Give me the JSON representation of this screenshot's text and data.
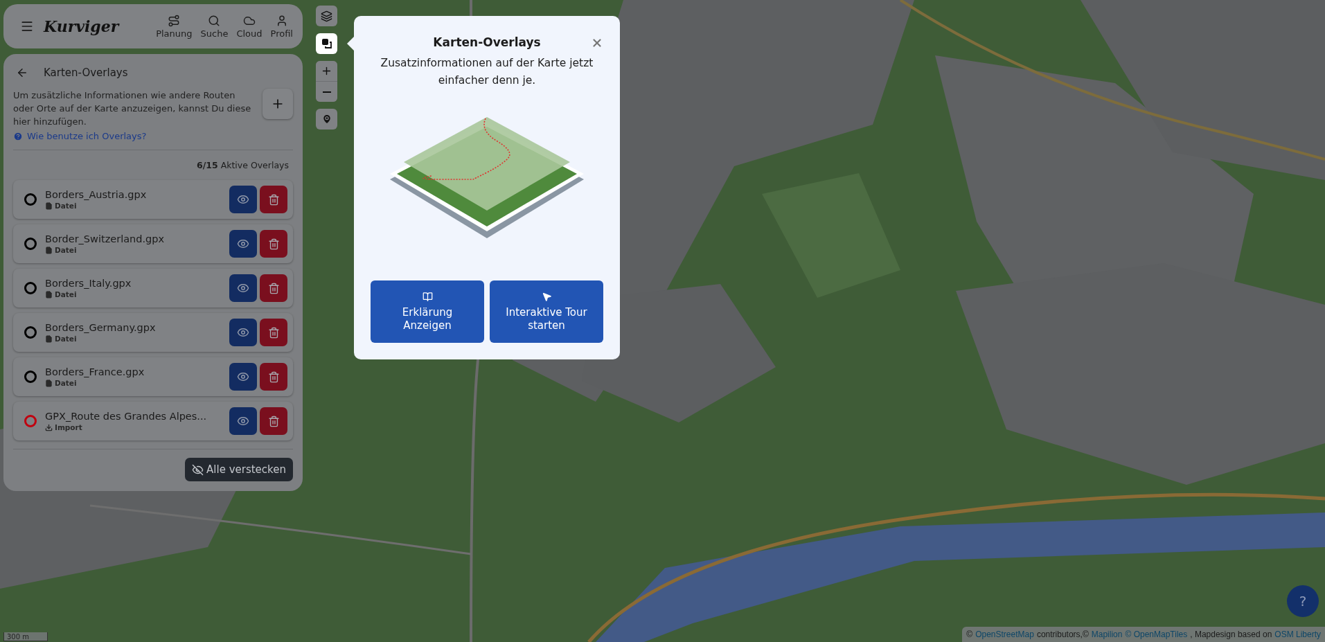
{
  "header": {
    "logo": "Kurviger",
    "nav": [
      {
        "kind": "route",
        "label": "Planung"
      },
      {
        "kind": "search",
        "label": "Suche"
      },
      {
        "kind": "cloud",
        "label": "Cloud"
      },
      {
        "kind": "user",
        "label": "Profil"
      }
    ]
  },
  "panel": {
    "title": "Karten-Overlays",
    "description": "Um zusätzliche Informationen wie andere Routen oder Orte auf der Karte anzuzeigen, kannst Du diese hier hinzufügen.",
    "help_link": "Wie benutze ich Overlays?",
    "count": "**6/15** Aktive Overlays",
    "overlays": [
      {
        "name": "Borders_Austria.gpx",
        "source": "Datei",
        "kind": "file",
        "color": "#000000"
      },
      {
        "name": "Border_Switzerland.gpx",
        "source": "Datei",
        "kind": "file",
        "color": "#000000"
      },
      {
        "name": "Borders_Italy.gpx",
        "source": "Datei",
        "kind": "file",
        "color": "#000000"
      },
      {
        "name": "Borders_Germany.gpx",
        "source": "Datei",
        "kind": "file",
        "color": "#000000"
      },
      {
        "name": "Borders_France.gpx",
        "source": "Datei",
        "kind": "file",
        "color": "#000000"
      },
      {
        "name": "GPX_Route des Grandes Alpes...",
        "source": "Import",
        "kind": "import",
        "color": "#c0000f"
      }
    ],
    "hide_all": "Alle verstecken"
  },
  "map_controls": [
    {
      "kind": "layers",
      "highlighted": false
    },
    {
      "kind": "overlays",
      "highlighted": true
    },
    {
      "kind": "zoom",
      "highlighted": false
    },
    {
      "kind": "locate",
      "highlighted": false
    }
  ],
  "popup": {
    "title": "Karten-Overlays",
    "text": "Zusatzinformationen auf der Karte jetzt einfacher denn je.",
    "buttons": [
      {
        "kind": "explain",
        "label": "Erklärung Anzeigen"
      },
      {
        "kind": "tour",
        "label": "Interaktive Tour starten"
      }
    ]
  },
  "scale": "300 m",
  "help_button": "?",
  "attribution": [
    {
      "kind": "text",
      "text": "©"
    },
    {
      "kind": "link",
      "text": "OpenStreetMap"
    },
    {
      "kind": "text",
      "text": "contributors,©"
    },
    {
      "kind": "link",
      "text": "Mapilion"
    },
    {
      "kind": "link",
      "text": "© OpenMapTiles"
    },
    {
      "kind": "text",
      "text": ", Mapdesign based on"
    },
    {
      "kind": "link",
      "text": "OSM Liberty"
    }
  ]
}
